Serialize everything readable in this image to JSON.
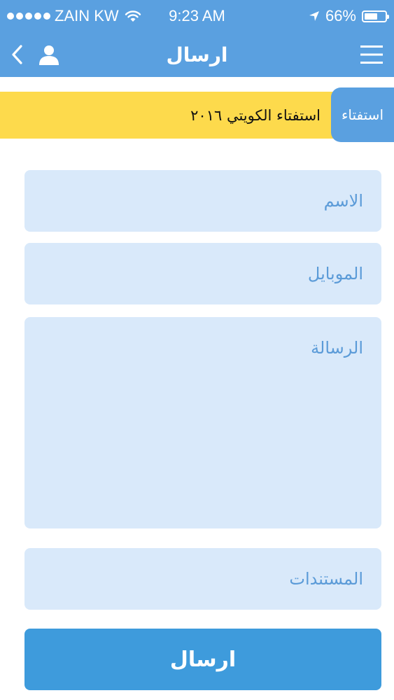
{
  "status_bar": {
    "carrier": "ZAIN KW",
    "time": "9:23 AM",
    "battery_text": "66%",
    "battery_level": 0.66,
    "signal_bars": 5
  },
  "nav": {
    "title": "ارسال",
    "back_icon": "chevron-left-icon",
    "user_icon": "user-icon",
    "menu_icon": "hamburger-menu-icon"
  },
  "poll": {
    "tab_label": "استفتاء",
    "text": "استفتاء الكويتي ٢٠١٦"
  },
  "form": {
    "name_placeholder": "الاسم",
    "mobile_placeholder": "الموبايل",
    "message_placeholder": "الرسالة",
    "documents_placeholder": "المستندات",
    "submit_label": "ارسال"
  },
  "colors": {
    "primary": "#5aa0e0",
    "banner": "#fdda4c",
    "field_bg": "#d9e9fa",
    "field_text": "#5b9bd8",
    "button": "#3e9bdc"
  }
}
